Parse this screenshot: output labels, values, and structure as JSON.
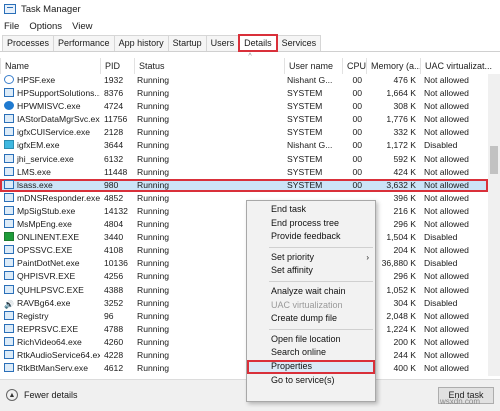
{
  "window": {
    "title": "Task Manager"
  },
  "menu": [
    "File",
    "Options",
    "View"
  ],
  "tabs": [
    {
      "label": "Processes",
      "active": false
    },
    {
      "label": "Performance",
      "active": false
    },
    {
      "label": "App history",
      "active": false
    },
    {
      "label": "Startup",
      "active": false
    },
    {
      "label": "Users",
      "active": false
    },
    {
      "label": "Details",
      "active": true
    },
    {
      "label": "Services",
      "active": false
    }
  ],
  "columns": [
    "Name",
    "PID",
    "Status",
    "User name",
    "CPU",
    "Memory (a...",
    "UAC virtualizat..."
  ],
  "rows": [
    {
      "icon": "help-icon",
      "name": "HPSF.exe",
      "pid": "1932",
      "status": "Running",
      "user": "Nishant G...",
      "cpu": "00",
      "mem": "476 K",
      "uac": "Not allowed"
    },
    {
      "icon": "app-icon",
      "name": "HPSupportSolutions...",
      "pid": "8376",
      "status": "Running",
      "user": "SYSTEM",
      "cpu": "00",
      "mem": "1,664 K",
      "uac": "Not allowed"
    },
    {
      "icon": "hp-icon",
      "name": "HPWMISVC.exe",
      "pid": "4724",
      "status": "Running",
      "user": "SYSTEM",
      "cpu": "00",
      "mem": "308 K",
      "uac": "Not allowed"
    },
    {
      "icon": "app-icon",
      "name": "IAStorDataMgrSvc.exe",
      "pid": "11756",
      "status": "Running",
      "user": "SYSTEM",
      "cpu": "00",
      "mem": "1,776 K",
      "uac": "Not allowed"
    },
    {
      "icon": "app-icon",
      "name": "igfxCUIService.exe",
      "pid": "2128",
      "status": "Running",
      "user": "SYSTEM",
      "cpu": "00",
      "mem": "332 K",
      "uac": "Not allowed"
    },
    {
      "icon": "cyan-icon",
      "name": "igfxEM.exe",
      "pid": "3644",
      "status": "Running",
      "user": "Nishant G...",
      "cpu": "00",
      "mem": "1,172 K",
      "uac": "Disabled"
    },
    {
      "icon": "app-icon",
      "name": "jhi_service.exe",
      "pid": "6132",
      "status": "Running",
      "user": "SYSTEM",
      "cpu": "00",
      "mem": "592 K",
      "uac": "Not allowed"
    },
    {
      "icon": "app-icon",
      "name": "LMS.exe",
      "pid": "11448",
      "status": "Running",
      "user": "SYSTEM",
      "cpu": "00",
      "mem": "424 K",
      "uac": "Not allowed"
    },
    {
      "icon": "app-icon",
      "name": "lsass.exe",
      "pid": "980",
      "status": "Running",
      "user": "SYSTEM",
      "cpu": "00",
      "mem": "3,632 K",
      "uac": "Not allowed",
      "selected": true
    },
    {
      "icon": "app-icon",
      "name": "mDNSResponder.exe",
      "pid": "4852",
      "status": "Running",
      "user": "",
      "cpu": "",
      "mem": "396 K",
      "uac": "Not allowed"
    },
    {
      "icon": "app-icon",
      "name": "MpSigStub.exe",
      "pid": "14132",
      "status": "Running",
      "user": "",
      "cpu": "",
      "mem": "216 K",
      "uac": "Not allowed"
    },
    {
      "icon": "app-icon",
      "name": "MsMpEng.exe",
      "pid": "4804",
      "status": "Running",
      "user": "",
      "cpu": "",
      "mem": "296 K",
      "uac": "Not allowed"
    },
    {
      "icon": "green-icon",
      "name": "ONLINENT.EXE",
      "pid": "3440",
      "status": "Running",
      "user": "",
      "cpu": "",
      "mem": "1,504 K",
      "uac": "Disabled"
    },
    {
      "icon": "app-icon",
      "name": "OPSSVC.EXE",
      "pid": "4108",
      "status": "Running",
      "user": "",
      "cpu": "",
      "mem": "204 K",
      "uac": "Not allowed"
    },
    {
      "icon": "app-icon",
      "name": "PaintDotNet.exe",
      "pid": "10136",
      "status": "Running",
      "user": "",
      "cpu": "",
      "mem": "36,880 K",
      "uac": "Disabled"
    },
    {
      "icon": "app-icon",
      "name": "QHPISVR.EXE",
      "pid": "4256",
      "status": "Running",
      "user": "",
      "cpu": "",
      "mem": "296 K",
      "uac": "Not allowed"
    },
    {
      "icon": "app-icon",
      "name": "QUHLPSVC.EXE",
      "pid": "4388",
      "status": "Running",
      "user": "",
      "cpu": "",
      "mem": "1,052 K",
      "uac": "Not allowed"
    },
    {
      "icon": "speaker-icon",
      "name": "RAVBg64.exe",
      "pid": "3252",
      "status": "Running",
      "user": "",
      "cpu": "",
      "mem": "304 K",
      "uac": "Disabled"
    },
    {
      "icon": "app-icon",
      "name": "Registry",
      "pid": "96",
      "status": "Running",
      "user": "",
      "cpu": "",
      "mem": "2,048 K",
      "uac": "Not allowed"
    },
    {
      "icon": "app-icon",
      "name": "REPRSVC.EXE",
      "pid": "4788",
      "status": "Running",
      "user": "",
      "cpu": "",
      "mem": "1,224 K",
      "uac": "Not allowed"
    },
    {
      "icon": "app-icon",
      "name": "RichVideo64.exe",
      "pid": "4260",
      "status": "Running",
      "user": "",
      "cpu": "",
      "mem": "200 K",
      "uac": "Not allowed"
    },
    {
      "icon": "app-icon",
      "name": "RtkAudioService64.exe",
      "pid": "4228",
      "status": "Running",
      "user": "",
      "cpu": "",
      "mem": "244 K",
      "uac": "Not allowed"
    },
    {
      "icon": "app-icon",
      "name": "RtkBtManServ.exe",
      "pid": "4612",
      "status": "Running",
      "user": "",
      "cpu": "",
      "mem": "400 K",
      "uac": "Not allowed"
    }
  ],
  "context_menu": [
    {
      "label": "End task"
    },
    {
      "label": "End process tree"
    },
    {
      "label": "Provide feedback"
    },
    {
      "separator": true
    },
    {
      "label": "Set priority",
      "submenu": true
    },
    {
      "label": "Set affinity"
    },
    {
      "separator": true
    },
    {
      "label": "Analyze wait chain"
    },
    {
      "label": "UAC virtualization",
      "disabled": true
    },
    {
      "label": "Create dump file"
    },
    {
      "separator": true
    },
    {
      "label": "Open file location"
    },
    {
      "label": "Search online"
    },
    {
      "label": "Properties",
      "highlighted": true
    },
    {
      "label": "Go to service(s)"
    }
  ],
  "footer": {
    "fewer_details": "Fewer details",
    "end_task": "End task"
  },
  "watermark": "wsxdn.com",
  "colors": {
    "highlight_border": "#d9303a",
    "selection_bg": "#cce4f7"
  }
}
